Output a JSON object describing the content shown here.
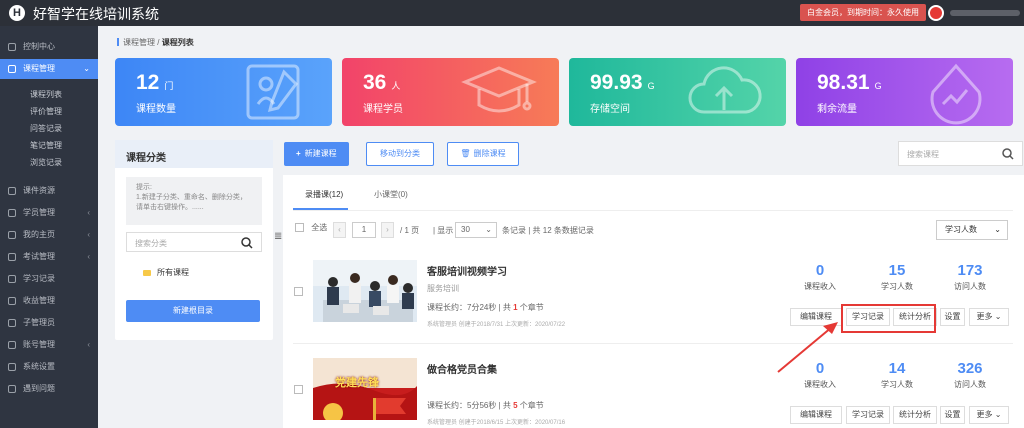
{
  "header": {
    "logo_letter": "H",
    "app_title": "好智学在线培训系统",
    "vip_label": "白金会员，到期时间：永久使用"
  },
  "sidebar": {
    "items": [
      {
        "label": "控制中心",
        "icon": "home-icon"
      },
      {
        "label": "课程管理",
        "icon": "book-icon"
      },
      {
        "label": "课件资源",
        "icon": "folder-icon"
      },
      {
        "label": "学员管理",
        "icon": "users-icon"
      },
      {
        "label": "我的主页",
        "icon": "page-icon"
      },
      {
        "label": "考试管理",
        "icon": "edit-icon"
      },
      {
        "label": "学习记录",
        "icon": "record-icon"
      },
      {
        "label": "收益管理",
        "icon": "money-icon"
      },
      {
        "label": "子管理员",
        "icon": "admin-icon"
      },
      {
        "label": "账号管理",
        "icon": "account-icon"
      },
      {
        "label": "系统设置",
        "icon": "gear-icon"
      },
      {
        "label": "遇到问题",
        "icon": "help-icon"
      }
    ],
    "sub_items": [
      "课程列表",
      "评价管理",
      "问答记录",
      "笔记管理",
      "浏览记录"
    ]
  },
  "breadcrumb": {
    "parent": "课程管理",
    "sep": "/",
    "current": "课程列表"
  },
  "stats": [
    {
      "value": "12",
      "unit": "门",
      "label": "课程数量",
      "color": "#3d86f6"
    },
    {
      "value": "36",
      "unit": "人",
      "label": "课程学员",
      "color": "#f2436a"
    },
    {
      "value": "99.93",
      "unit": "G",
      "label": "存储空间",
      "color": "#1fb89b"
    },
    {
      "value": "98.31",
      "unit": "G",
      "label": "剩余流量",
      "color": "#8f41e6"
    }
  ],
  "category": {
    "title": "课程分类",
    "tips": "提示:\n1.新建子分类、重命名、删除分类，请单击右键操作。......",
    "search_placeholder": "搜索分类",
    "folder": "所有课程",
    "new_root": "新建根目录",
    "drag_handle": "≣"
  },
  "actions": {
    "new_course": "新建课程",
    "move": "移动到分类",
    "delete": "删除课程",
    "search_placeholder": "搜索课程"
  },
  "tabs": [
    {
      "label": "录播课(12)"
    },
    {
      "label": "小课堂(0)"
    }
  ],
  "toolbar": {
    "select_all": "全选",
    "page": "1",
    "page_total": "/ 1 页",
    "show": "| 显示",
    "page_size": "30",
    "records": "条记录 | 共 12 条数据记录",
    "sort": "学习人数"
  },
  "courses": [
    {
      "name": "客服培训视频学习",
      "tag": "服务培训",
      "duration_label": "课程长约：",
      "duration": "7分24秒",
      "chapters_pre": "| 共 ",
      "chapters": "1",
      "chapters_post": " 个章节",
      "meta": "系统管理员 创建于2018/7/31 上次更新：2020/07/22",
      "income": "0",
      "income_label": "课程收入",
      "learners": "15",
      "learners_label": "学习人数",
      "visits": "173",
      "visits_label": "访问人数",
      "btn_edit": "编辑课程",
      "btn_record": "学习记录",
      "btn_analysis": "统计分析",
      "btn_settings": "设置",
      "btn_more": "更多"
    },
    {
      "name": "做合格党员合集",
      "tag": "",
      "duration_label": "课程长约：",
      "duration": "5分56秒",
      "chapters_pre": "| 共 ",
      "chapters": "5",
      "chapters_post": " 个章节",
      "meta": "系统管理员 创建于2018/6/15 上次更新：2020/07/16",
      "income": "0",
      "income_label": "课程收入",
      "learners": "14",
      "learners_label": "学习人数",
      "visits": "326",
      "visits_label": "访问人数",
      "btn_edit": "编辑课程",
      "btn_record": "学习记录",
      "btn_analysis": "统计分析",
      "btn_settings": "设置",
      "btn_more": "更多",
      "thumb_text": "党建先锋"
    }
  ],
  "colors": {
    "accent": "#4e8cf4",
    "highlight": "#e53935"
  }
}
